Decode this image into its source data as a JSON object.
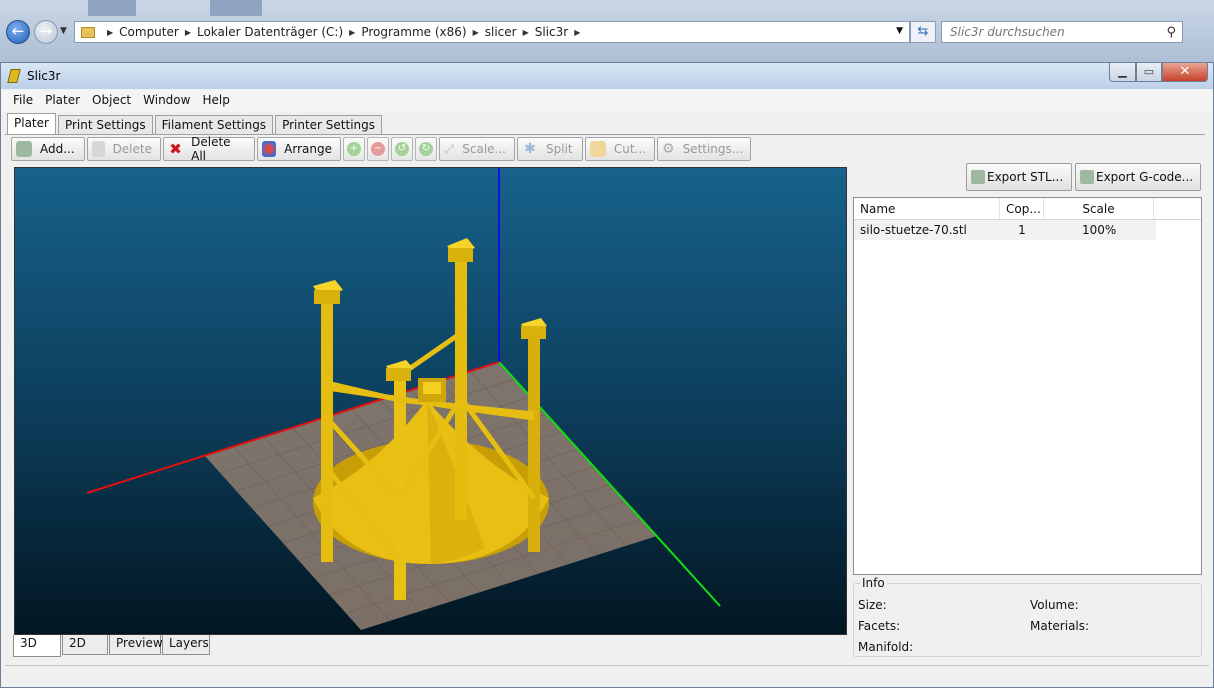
{
  "explorer": {
    "breadcrumb": [
      "Computer",
      "Lokaler Datenträger (C:)",
      "Programme (x86)",
      "slicer",
      "Slic3r"
    ],
    "search_placeholder": "Slic3r durchsuchen"
  },
  "window": {
    "title": "Slic3r"
  },
  "menu": [
    "File",
    "Plater",
    "Object",
    "Window",
    "Help"
  ],
  "tabs": [
    "Plater",
    "Print Settings",
    "Filament Settings",
    "Printer Settings"
  ],
  "toolbar": {
    "add": "Add...",
    "delete": "Delete",
    "delete_all": "Delete All",
    "arrange": "Arrange",
    "scale": "Scale...",
    "split": "Split",
    "cut": "Cut...",
    "settings": "Settings..."
  },
  "view_tabs": [
    "3D",
    "2D",
    "Preview",
    "Layers"
  ],
  "export": {
    "stl": "Export STL...",
    "gcode": "Export G-code..."
  },
  "object_list": {
    "columns": [
      "Name",
      "Cop...",
      "Scale"
    ],
    "rows": [
      {
        "name": "silo-stuetze-70.stl",
        "copies": "1",
        "scale": "100%"
      }
    ]
  },
  "info": {
    "title": "Info",
    "size": "Size:",
    "volume": "Volume:",
    "facets": "Facets:",
    "materials": "Materials:",
    "manifold": "Manifold:"
  },
  "colors": {
    "model": "#f0c814",
    "bed": "#8a7a6e",
    "axis_x": "#e01010",
    "axis_y": "#10e010",
    "axis_z": "#1010e0"
  }
}
